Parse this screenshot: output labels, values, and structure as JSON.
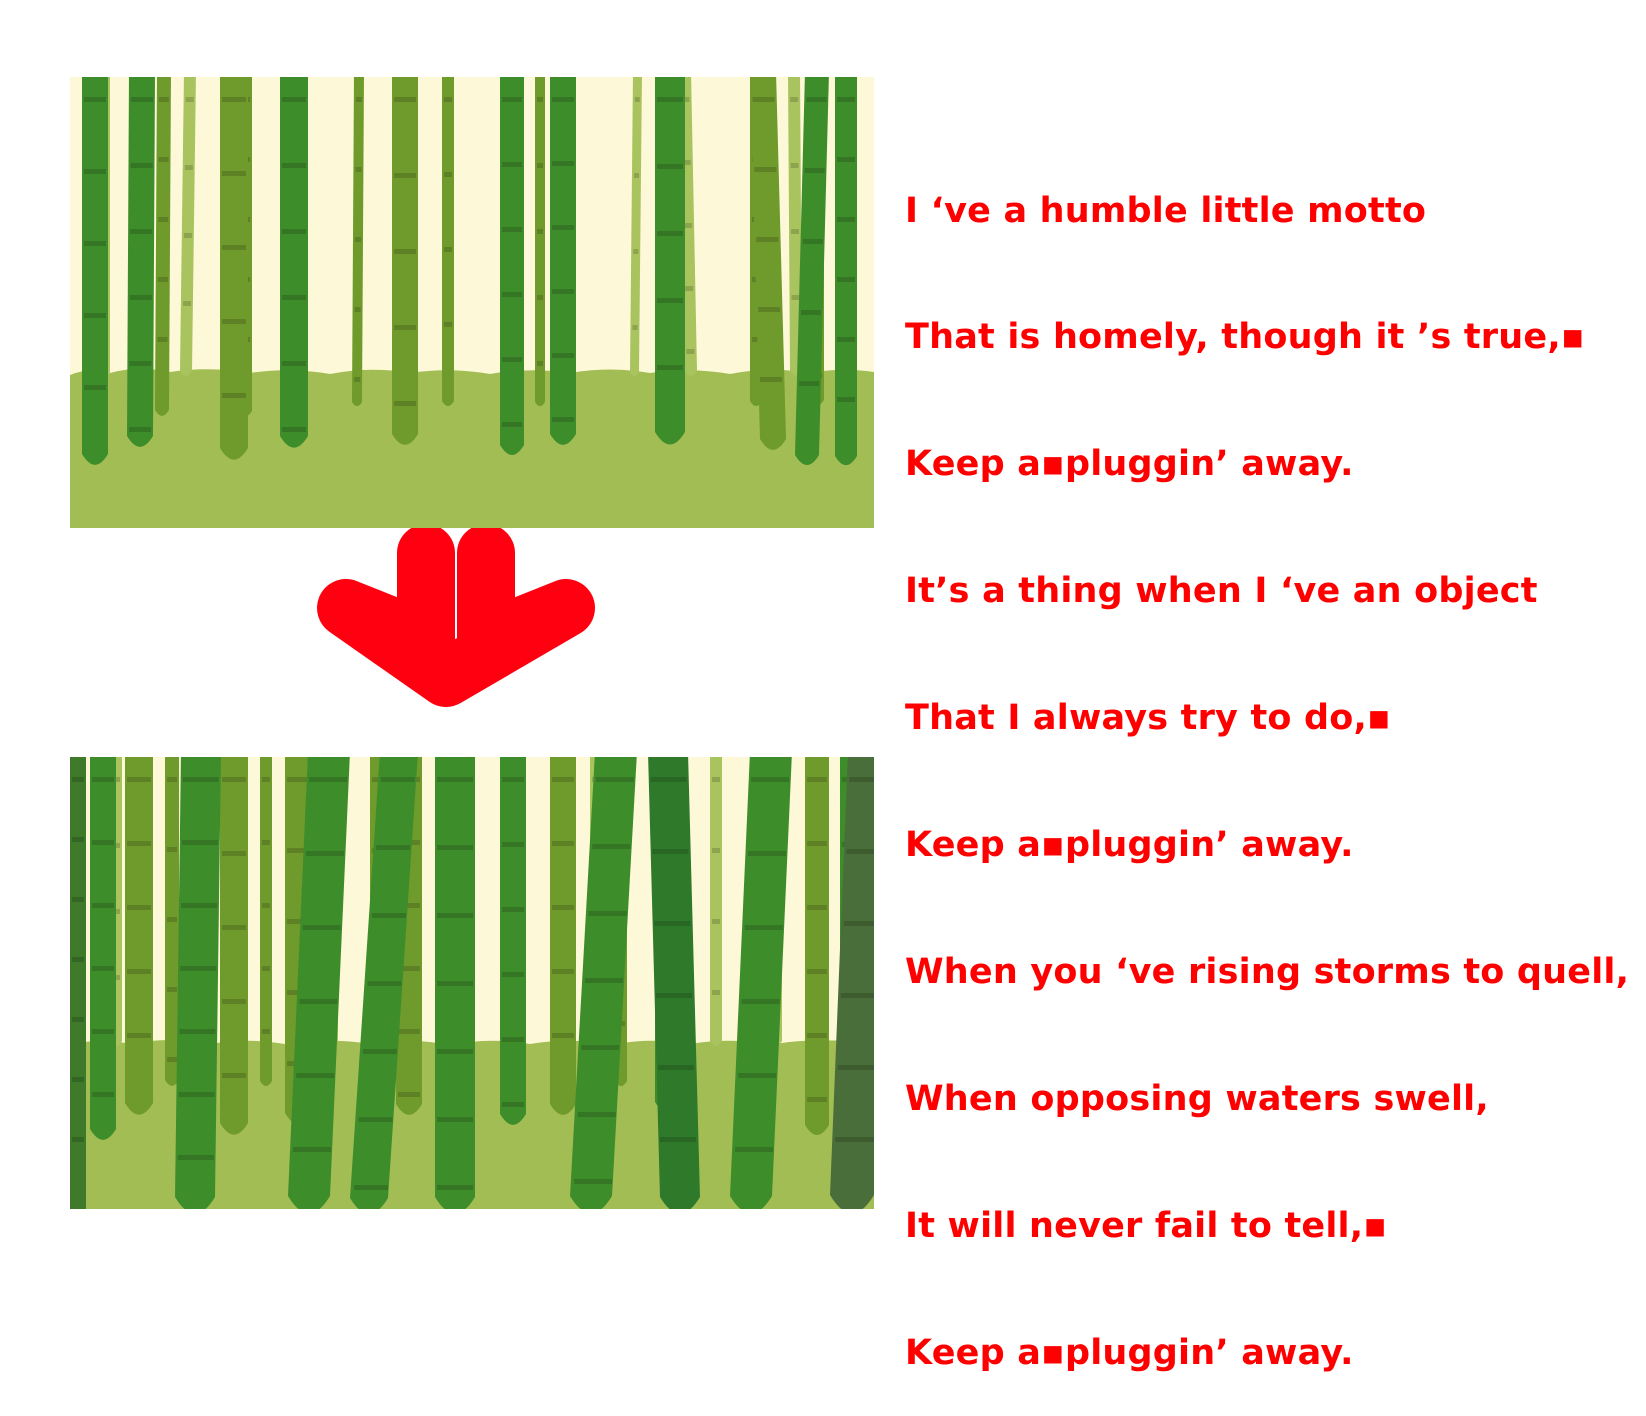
{
  "colors": {
    "sky": "#fdf9d8",
    "ground": "#a3bd55",
    "bamboo_light": "#a9c35e",
    "bamboo_mid": "#6f9a2c",
    "bamboo_dark": "#3e8d2b",
    "arrow": "#ff0010",
    "text": "#ff0000"
  },
  "images": {
    "before": {
      "icon": "sparse-bamboo-forest-illustration"
    },
    "arrow": {
      "icon": "down-arrow-icon"
    },
    "after": {
      "icon": "dense-bamboo-forest-illustration"
    }
  },
  "poem": {
    "lines": [
      "I ‘ve a humble little motto",
      "That is homely, though it ’s true,▪",
      "Keep a▪pluggin’ away.",
      "It’s a thing when I ‘ve an object",
      "That I always try to do,▪",
      "Keep a▪pluggin’ away.",
      "When you ‘ve rising storms to quell,",
      "When opposing waters swell,",
      "It will never fail to tell,▪",
      "Keep a▪pluggin’ away."
    ]
  }
}
